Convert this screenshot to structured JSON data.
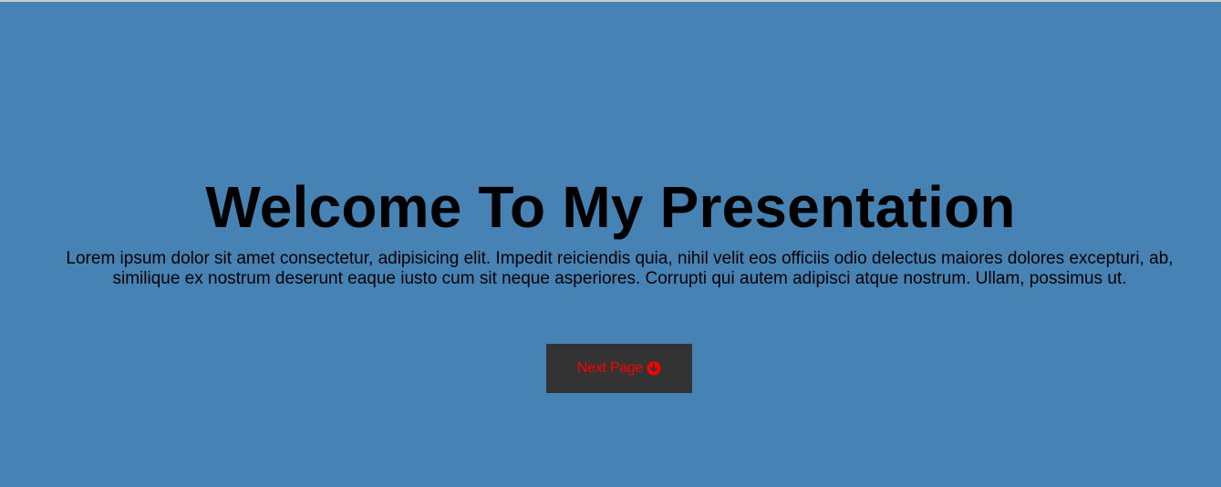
{
  "hero": {
    "title": "Welcome To My Presentation",
    "lead": "Lorem ipsum dolor sit amet consectetur, adipisicing elit. Impedit reiciendis quia, nihil velit eos officiis odio delectus maiores dolores excepturi, ab, similique ex nostrum deserunt eaque iusto cum sit neque asperiores. Corrupti qui autem adipisci atque nostrum. Ullam, possimus ut.",
    "button": {
      "label": "Next Page",
      "icon": "arrow-circle-down-icon"
    }
  },
  "colors": {
    "background": "#4682b4",
    "button_bg": "#333333",
    "button_text": "#ff0000"
  }
}
